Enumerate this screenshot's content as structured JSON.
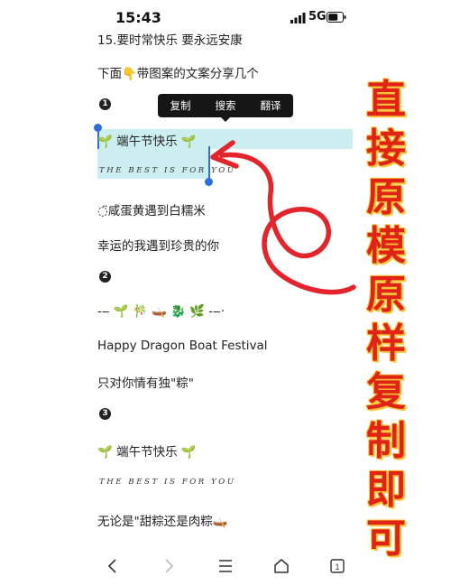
{
  "status_bar": {
    "time": "15:43",
    "network": "5G"
  },
  "context_menu": {
    "items": [
      "复制",
      "搜索",
      "翻译"
    ]
  },
  "lines": {
    "l1": "15.要时常快乐 要永远安康",
    "l2": "下面👇带图案的文案分享几个",
    "sel_title": "🌱 端午节快乐 🌱",
    "sel_fancy": "THE BEST IS FOR YOU",
    "l3": "◌̈咸蛋黄遇到白糯米",
    "l4": "幸运的我遇到珍贵的你",
    "l5": "-‒ 🌱 🎋 🛶 🐉 🌿 -‒·",
    "l6": "Happy Dragon Boat Festival",
    "l7": "只对你情有独\"粽\"",
    "l8": "🌱 端午节快乐 🌱",
    "l8_fancy": "THE BEST IS FOR YOU",
    "l9": "无论是\"甜粽还是肉粽🛶"
  },
  "badges": {
    "b1": "1",
    "b2": "2",
    "b3": "3"
  },
  "overlay_chars": [
    "直",
    "接",
    "原",
    "模",
    "原",
    "样",
    "复",
    "制",
    "即",
    "可"
  ],
  "nav": {
    "tab_count": "1"
  },
  "colors": {
    "selection": "#cdeef0",
    "accent_red": "#e12217",
    "handle_blue": "#2d6fd8"
  }
}
